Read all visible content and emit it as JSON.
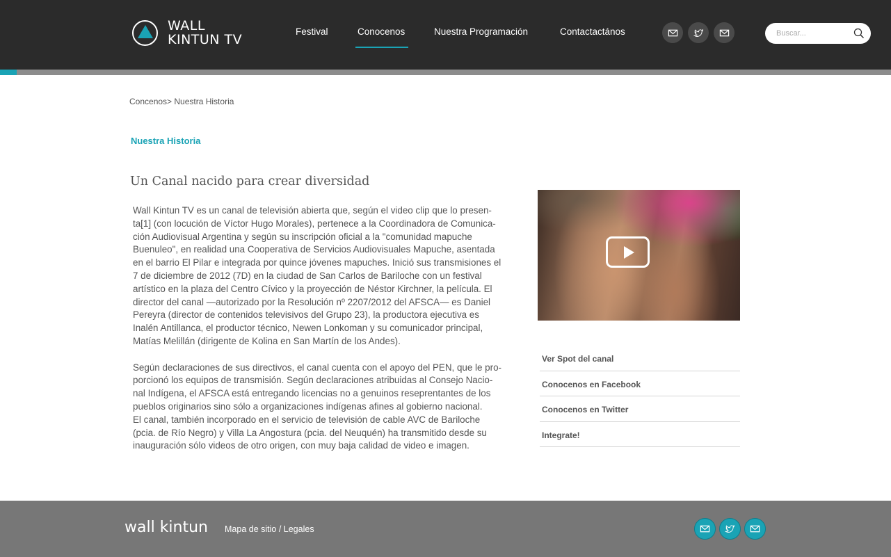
{
  "brand": {
    "line1": "WALL",
    "line2": "KINTUN TV",
    "accent_color": "#1aa3b5"
  },
  "nav": {
    "items": [
      {
        "label": "Festival",
        "active": false
      },
      {
        "label": "Conocenos",
        "active": true
      },
      {
        "label": "Nuestra Programación",
        "active": false
      },
      {
        "label": "Contactactános",
        "active": false
      }
    ]
  },
  "social_top": [
    {
      "icon": "mail-icon"
    },
    {
      "icon": "twitter-icon"
    },
    {
      "icon": "mail-icon"
    }
  ],
  "search": {
    "placeholder": "Buscar...",
    "icon": "search-icon"
  },
  "breadcrumb": "Concenos> Nuestra Historia",
  "section_title": "Nuestra Historia",
  "headline": "Un Canal nacido para crear diversidad",
  "body": {
    "p1_lines": [
      "Wall Kintun TV es un canal de televisión abierta que, según el video clip que lo presen-",
      "ta[1] (con locución de Víctor Hugo Morales), pertenece a la Coordinadora de Comunica-",
      "ción Audiovisual Argentina y según su inscripción oficial a la \"comunidad mapuche",
      "Buenuleo\", en realidad una Cooperativa de Servicios Audiovisuales Mapuche, asentada",
      "en el barrio El Pilar e integrada por quince jóvenes mapuches. Inició sus transmisiones el",
      "7 de diciembre de 2012 (7D) en la ciudad de San Carlos de Bariloche con un festival",
      "artístico en la plaza del Centro Cívico y la proyección de Néstor Kirchner, la película. El",
      "director del canal —autorizado por la Resolución nº 2207/2012 del AFSCA— es Daniel",
      "Pereyra (director de contenidos televisivos del Grupo 23), la productora ejecutiva es",
      "Inalén Antillanca, el productor técnico, Newen Lonkoman y su comunicador principal,",
      "Matías Melillán (dirigente de Kolina en San Martín de los Andes)."
    ],
    "p2_lines": [
      "Según declaraciones de sus directivos, el canal cuenta con el apoyo del PEN, que le pro-",
      "porcionó los equipos de transmisión. Según declaraciones atribuidas al Consejo Nacio-",
      "nal Indígena, el AFSCA está entregando licencias no a genuinos reseprentantes de los",
      "pueblos originarios sino sólo a organizaciones indígenas afines al gobierno nacional.",
      "El canal, también incorporado en el servicio de televisión de cable AVC de Bariloche",
      "(pcia. de Río Negro) y Villa La Angostura (pcia. del Neuquén) ha transmitido desde su",
      "inauguración sólo videos de otro origen, con muy baja calidad de video e imagen."
    ]
  },
  "video": {
    "icon": "play-icon"
  },
  "side_links": [
    "Ver Spot del canal",
    "Conocenos en Facebook",
    "Conocenos en Twitter",
    "Integrate!"
  ],
  "footer": {
    "logo": "wall kintun",
    "sitemap": "Mapa de sitio",
    "separator": " / ",
    "legal": "Legales"
  },
  "social_bottom": [
    {
      "icon": "mail-icon"
    },
    {
      "icon": "twitter-icon"
    },
    {
      "icon": "mail-icon"
    }
  ]
}
